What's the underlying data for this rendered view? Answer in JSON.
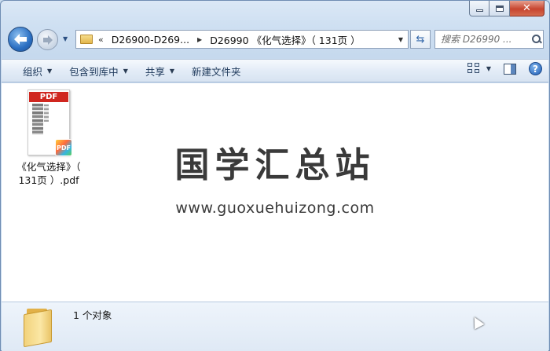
{
  "window": {
    "caption": {
      "minimize_label": "",
      "maximize_label": "",
      "close_label": "✕"
    }
  },
  "nav": {
    "back_glyph": "◀",
    "forward_glyph": "▶",
    "history_glyph": "▼"
  },
  "address": {
    "overflow_glyph": "«",
    "crumbs": [
      "D26900-D269...",
      "D26990 《化气选择》（ 131页 ）"
    ],
    "separator_glyph": "▶",
    "dropdown_glyph": "▼",
    "refresh_glyph": "⇆"
  },
  "search": {
    "placeholder": "搜索 D26990 ..."
  },
  "commands": {
    "organize": "组织",
    "include_in_library": "包含到库中",
    "share": "共享",
    "new_folder": "新建文件夹",
    "dropdown_glyph": "▼",
    "help_glyph": "?"
  },
  "file": {
    "banner": "PDF",
    "badge": "PDF",
    "name_line1": "《化气选择》（",
    "name_line2": "131页 ）.pdf"
  },
  "watermark": {
    "title": "国学汇总站",
    "url": "www.guoxuehuizong.com"
  },
  "details": {
    "object_count": "1 个对象"
  },
  "icons": [
    "back-arrow-icon",
    "forward-arrow-icon",
    "folder-icon",
    "refresh-icon",
    "search-icon",
    "views-icon",
    "preview-pane-icon",
    "help-icon",
    "pdf-file-icon",
    "folder-large-icon",
    "mouse-cursor-icon"
  ],
  "colors": {
    "accent": "#2a6fc2",
    "close": "#c7452f",
    "pdf_red": "#d0261f"
  }
}
